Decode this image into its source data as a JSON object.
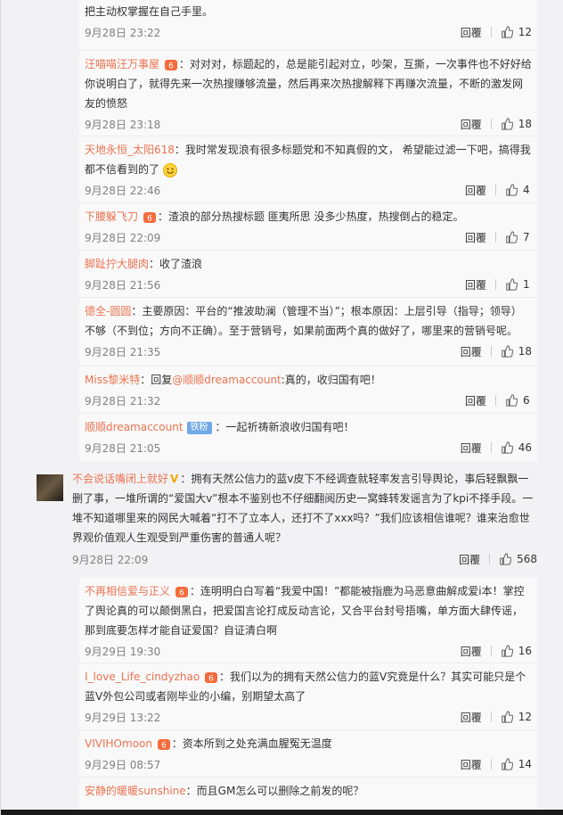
{
  "replies_top": [
    {
      "name": "",
      "text": "把主动权掌握在自己手里。",
      "time": "9月28日 23:22",
      "reply": "回覆",
      "likes": "12"
    },
    {
      "name": "汪喵喵汪万事屋",
      "text": "对对对，标题起的，总是能引起对立，吵架，互撕，一次事件也不好好给你说明白了，就得先来一次热搜赚够流量，然后再来次热搜解释下再赚次流量，不断的激发网友的愤怒",
      "time": "9月28日 23:18",
      "reply": "回覆",
      "likes": "18"
    },
    {
      "name": "天地永恒_太阳618",
      "text": "我时常发现浪有很多标题党和不知真假的文， 希望能过滤一下吧，搞得我都不信看到的了",
      "time": "9月28日 22:46",
      "reply": "回覆",
      "likes": "4"
    },
    {
      "name": "下腰躲飞刀",
      "text": "渣浪的部分热搜标题 匪夷所思 没多少热度，热搜倒占的稳定。",
      "time": "9月28日 22:09",
      "reply": "回覆",
      "likes": "7"
    },
    {
      "name": "脚趾拧大腿肉",
      "text": "收了渣浪",
      "time": "9月28日 21:56",
      "reply": "回覆",
      "likes": "1"
    },
    {
      "name": "德全-圆圆",
      "text": "主要原因：平台的“推波助澜（管理不当）”；根本原因：上层引导（指导；领导）不够（不到位；方向不正确）。至于营销号，如果前面两个真的做好了，哪里来的营销号呢。",
      "time": "9月28日 21:35",
      "reply": "回覆",
      "likes": "18"
    },
    {
      "name": "Miss黎米特",
      "text_prefix": "回复",
      "mention": "@顺顺dreamaccount",
      "text": ":真的，收归国有吧！",
      "time": "9月28日 21:32",
      "reply": "回覆",
      "likes": "6"
    },
    {
      "name": "顺顺dreamaccount",
      "fan": "铁粉",
      "text": "一起祈祷新浪收归国有吧！",
      "time": "9月28日 21:05",
      "reply": "回覆",
      "likes": "46"
    }
  ],
  "main": {
    "name": "不会说话嘴闭上就好",
    "text": "拥有天然公信力的蓝v皮下不经调查就轻率发言引导舆论，事后轻飘飘一删了事，一堆所谓的“爱国大v”根本不鉴别也不仔细翻阅历史一窝蜂转发谣言为了kpi不择手段。一堆不知道哪里来的网民大喊着“打不了立本人，还打不了xxx吗？”我们应该相信谁呢？谁来治愈世界观价值观人生观受到严重伤害的普通人呢？",
    "time": "9月28日 22:09",
    "reply": "回覆",
    "likes": "568"
  },
  "replies_bottom": [
    {
      "name": "不再相信爱与正义",
      "text": "连明明白白写着“我爱中国！”都能被指鹿为马恶意曲解成爱i本！掌控了舆论真的可以颠倒黑白，把爱国言论打成反动言论，又合平台封号捂嘴，单方面大肆传谣，那到底要怎样才能自证爱国？自证清白啊",
      "time": "9月29日 19:30",
      "reply": "回覆",
      "likes": "16"
    },
    {
      "name": "I_love_Life_cindyzhao",
      "text": "我们以为的拥有天然公信力的蓝V究竟是什么？其实可能只是个蓝V外包公司或者刚毕业的小编，别期望太高了",
      "time": "9月29日 13:22",
      "reply": "回覆",
      "likes": "12"
    },
    {
      "name": "VIVIHOmoon",
      "text": "资本所到之处充满血腥冤无温度",
      "time": "9月29日 08:57",
      "reply": "回覆",
      "likes": "14"
    },
    {
      "name": "安静的暖暖sunshine",
      "text": "而且GM怎么可以删除之前发的呢？",
      "time": "",
      "reply": "",
      "likes": ""
    }
  ],
  "colors": {
    "name": "#eb7350",
    "background": "#f2f2f5",
    "nested": "#f9f9f9"
  },
  "icons": {
    "like": "thumbs-up-icon",
    "badge": "member-badge-icon",
    "verified": "yellow-v-icon",
    "emoji": "smile-emoji-icon"
  }
}
